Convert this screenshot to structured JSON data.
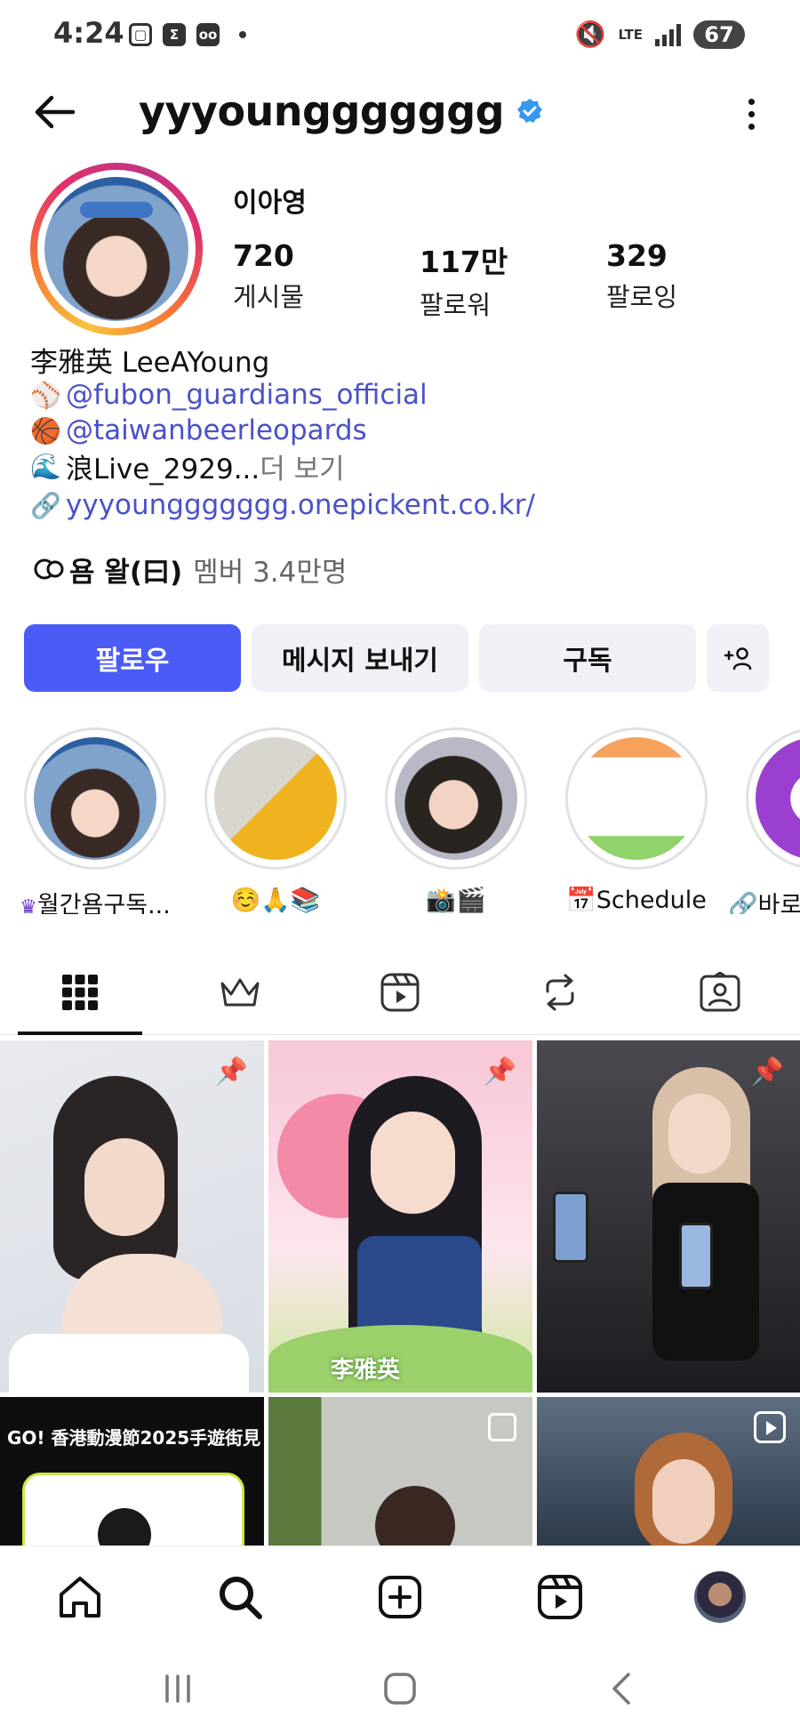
{
  "status_bar": {
    "time": "4:24",
    "network": "LTE",
    "battery": "67"
  },
  "header": {
    "username": "yyyounggggggg",
    "verified": true
  },
  "profile": {
    "full_name": "이아영",
    "stats": [
      {
        "value": "720",
        "label": "게시물"
      },
      {
        "value": "117만",
        "label": "팔로워"
      },
      {
        "value": "329",
        "label": "팔로잉"
      }
    ],
    "bio": {
      "name_line": "李雅英 LeeAYoung",
      "mention1": "@fubon_guardians_official",
      "mention2": "@taiwanbeerleopards",
      "live_line": "浪Live_2929...",
      "more": " 더 보기",
      "link": "yyyounggggggg.onepickent.co.kr/"
    },
    "channel": {
      "name": "욤 왈(曰)",
      "members": "멤버 3.4만명"
    }
  },
  "buttons": {
    "follow": "팔로우",
    "message": "메시지 보내기",
    "subscribe": "구독",
    "add_user": "+👤"
  },
  "highlights": [
    {
      "label": "월간욤구독..."
    },
    {
      "label": "☺️🙏📚"
    },
    {
      "label": "📸🎬"
    },
    {
      "label": "📅Schedule"
    },
    {
      "label": "🔗바로"
    }
  ],
  "colors": {
    "primary_button": "#4b5cf6",
    "link": "#4a52c8",
    "verified": "#3897f0"
  },
  "grid_overlays": {
    "cell2_text": "李雅英",
    "cell4_text": "GO! 香港動漫節2025手遊街見"
  }
}
